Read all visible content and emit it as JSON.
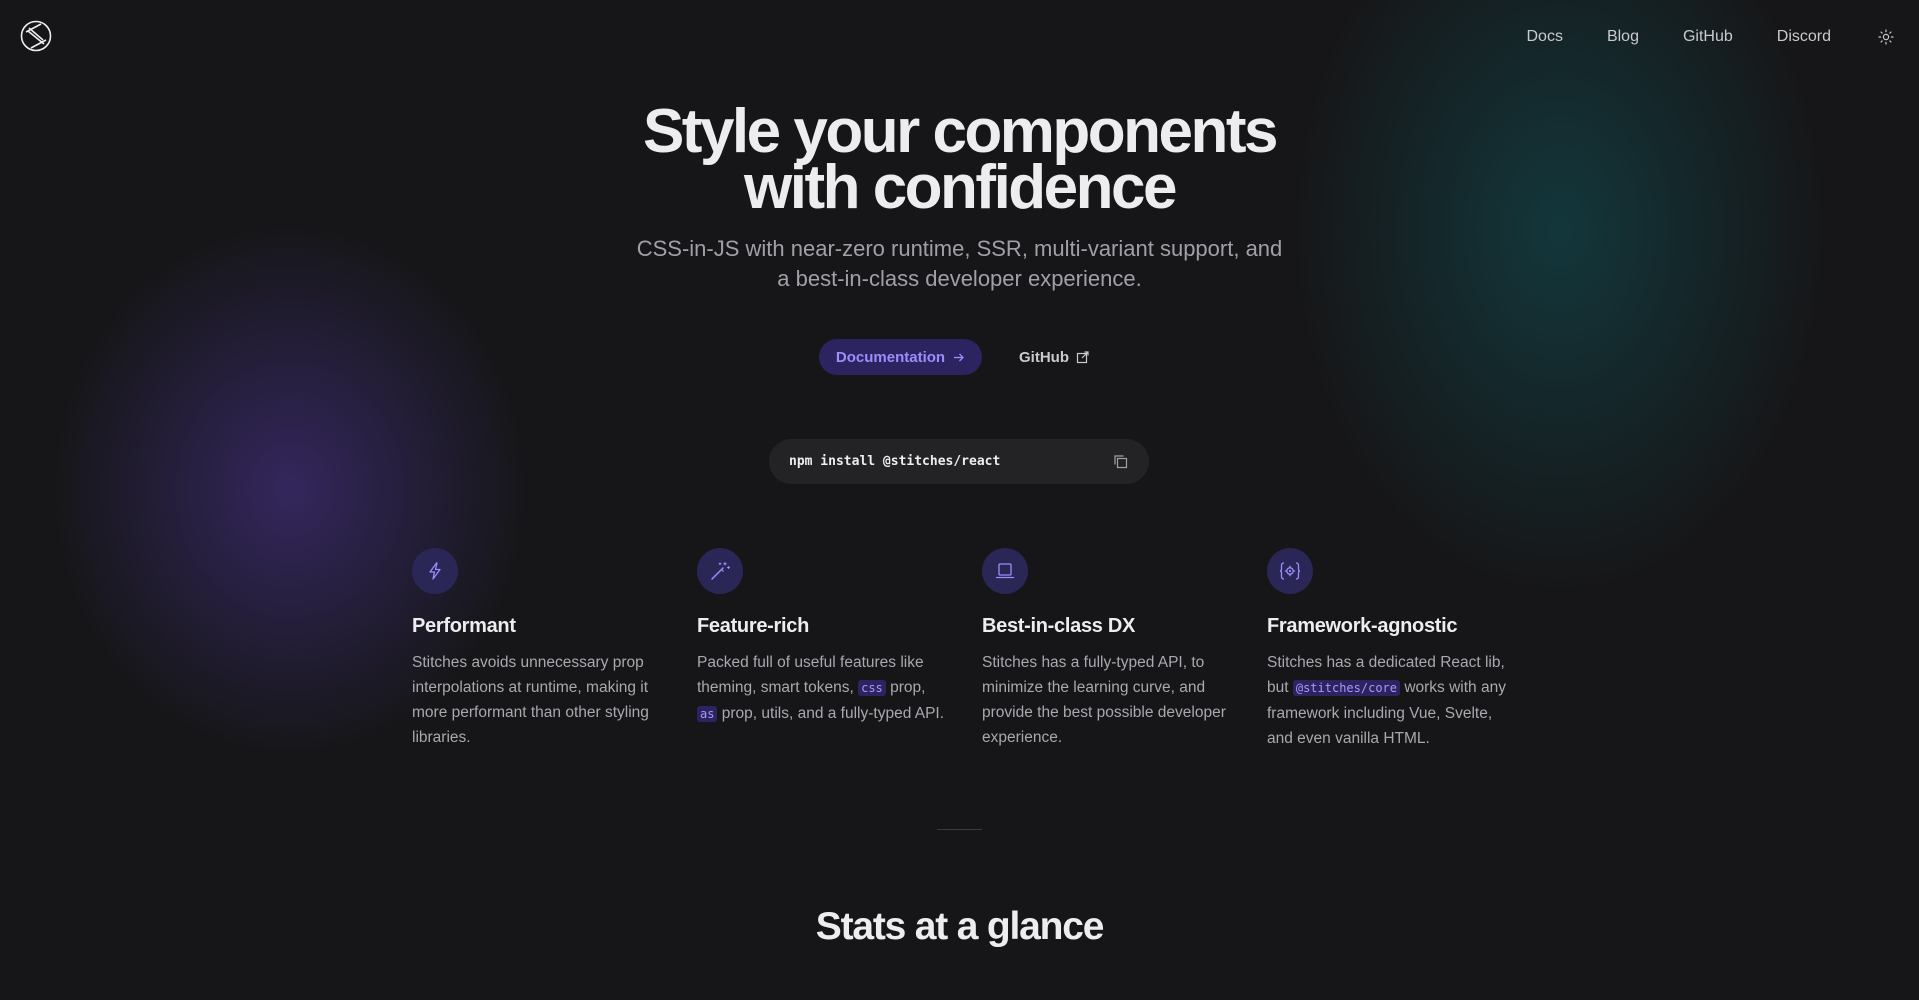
{
  "nav": {
    "links": [
      "Docs",
      "Blog",
      "GitHub",
      "Discord"
    ]
  },
  "hero": {
    "title_line1": "Style your components",
    "title_line2": "with confidence",
    "subtitle_line1": "CSS-in-JS with near-zero runtime, SSR, multi-variant support, and",
    "subtitle_line2": "a best-in-class developer experience.",
    "doc_button": "Documentation",
    "github_button": "GitHub"
  },
  "install": {
    "command": "npm install @stitches/react"
  },
  "features": [
    {
      "icon": "lightning-icon",
      "title": "Performant",
      "desc": "Stitches avoids unnecessary prop interpolations at runtime, making it more performant than other styling libraries."
    },
    {
      "icon": "magic-wand-icon",
      "title": "Feature-rich",
      "desc_a": "Packed full of useful features like theming, smart tokens, ",
      "code_a": "css",
      "desc_b": " prop, ",
      "code_b": "as",
      "desc_c": " prop, utils, and a fully-typed API."
    },
    {
      "icon": "laptop-icon",
      "title": "Best-in-class DX",
      "desc": "Stitches has a fully-typed API, to minimize the learning curve, and provide the best possible developer experience."
    },
    {
      "icon": "code-gear-icon",
      "title": "Framework-agnostic",
      "desc_a": "Stitches has a dedicated React lib, but ",
      "code_a": "@stitches/core",
      "desc_b": " works with any framework including Vue, Svelte, and even vanilla HTML."
    }
  ],
  "stats": {
    "title": "Stats at a glance"
  },
  "colors": {
    "background": "#161618",
    "accent": "#9e8cfc",
    "accent_bg": "#2c2461"
  }
}
